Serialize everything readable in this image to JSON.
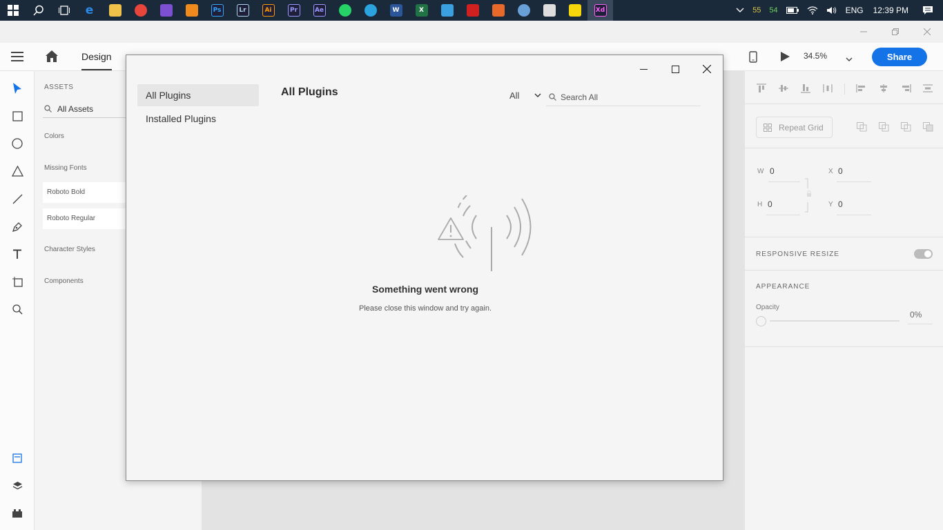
{
  "taskbar": {
    "apps": [
      {
        "name": "windows-start",
        "glyph": "",
        "color": "#ffffff"
      },
      {
        "name": "search",
        "glyph": "",
        "color": "#ffffff"
      },
      {
        "name": "task-view",
        "glyph": "",
        "color": "#ffffff"
      },
      {
        "name": "edge",
        "glyph": "e",
        "color": "#2b8ae8"
      },
      {
        "name": "file-explorer",
        "glyph": "",
        "color": "#f0c24a"
      },
      {
        "name": "chrome",
        "glyph": "",
        "color": "#e8453c"
      },
      {
        "name": "visual-studio",
        "glyph": "",
        "color": "#7d4fd1"
      },
      {
        "name": "vlc",
        "glyph": "",
        "color": "#f08a1c"
      },
      {
        "name": "photoshop",
        "glyph": "Ps",
        "color": "#31a8ff"
      },
      {
        "name": "lightroom",
        "glyph": "Lr",
        "color": "#add5ec"
      },
      {
        "name": "illustrator",
        "glyph": "Ai",
        "color": "#ff9a00"
      },
      {
        "name": "premiere",
        "glyph": "Pr",
        "color": "#9999ff"
      },
      {
        "name": "after-effects",
        "glyph": "Ae",
        "color": "#9999ff"
      },
      {
        "name": "whatsapp",
        "glyph": "",
        "color": "#25d366"
      },
      {
        "name": "telegram",
        "glyph": "",
        "color": "#2aa3df"
      },
      {
        "name": "word",
        "glyph": "W",
        "color": "#2b579a"
      },
      {
        "name": "excel",
        "glyph": "X",
        "color": "#217346"
      },
      {
        "name": "app-blue",
        "glyph": "",
        "color": "#3aa0e0"
      },
      {
        "name": "app-red",
        "glyph": "",
        "color": "#d02020"
      },
      {
        "name": "app-orange",
        "glyph": "",
        "color": "#e86a2a"
      },
      {
        "name": "paint",
        "glyph": "",
        "color": "#6aa0d8"
      },
      {
        "name": "calculator",
        "glyph": "",
        "color": "#dddddd"
      },
      {
        "name": "sticky-notes",
        "glyph": "",
        "color": "#f5d60b"
      },
      {
        "name": "xd",
        "glyph": "Xd",
        "color": "#ff61f6"
      }
    ],
    "tray_num_1": "55",
    "tray_num_2": "54",
    "language": "ENG",
    "clock": "12:39 PM"
  },
  "header": {
    "tab_design": "Design",
    "zoom": "34.5%",
    "share_label": "Share"
  },
  "assets": {
    "heading": "ASSETS",
    "search_value": "All Assets",
    "colors": "Colors",
    "missing_fonts": "Missing Fonts",
    "fonts": [
      "Roboto Bold",
      "Roboto Regular"
    ],
    "character_styles": "Character Styles",
    "components": "Components"
  },
  "inspector": {
    "repeat_grid": "Repeat Grid",
    "w_label": "W",
    "w_value": "0",
    "x_label": "X",
    "x_value": "0",
    "h_label": "H",
    "h_value": "0",
    "y_label": "Y",
    "y_value": "0",
    "responsive_resize": "RESPONSIVE RESIZE",
    "appearance": "APPEARANCE",
    "opacity_label": "Opacity",
    "opacity_value": "0%"
  },
  "dialog": {
    "nav": [
      "All Plugins",
      "Installed Plugins"
    ],
    "title": "All Plugins",
    "filter_value": "All",
    "search_placeholder": "Search All",
    "error_title": "Something went wrong",
    "error_message": "Please close this window and try again."
  }
}
